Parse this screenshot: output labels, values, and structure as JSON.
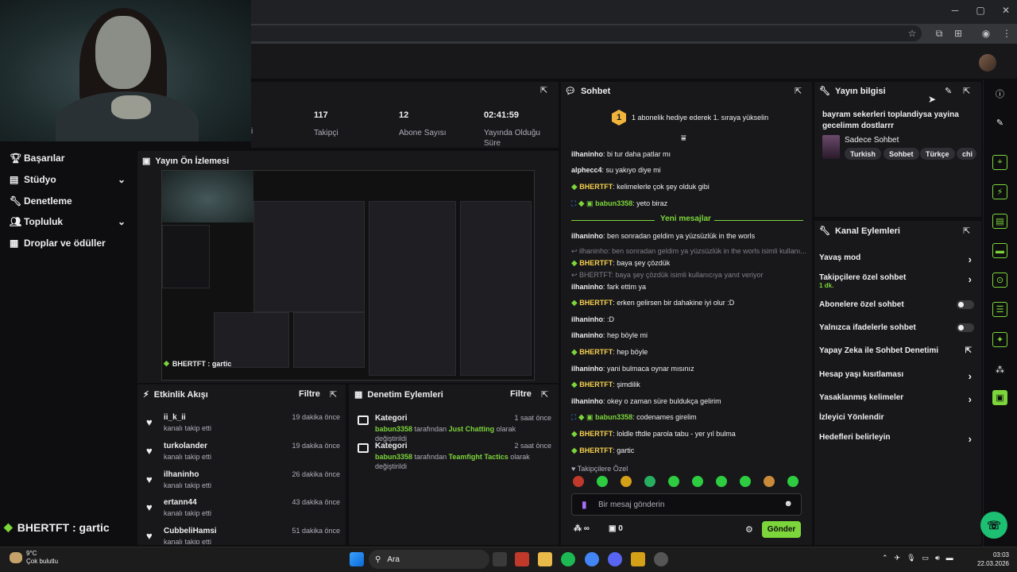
{
  "stats": {
    "items": [
      {
        "value": "117",
        "label": "Takipçi"
      },
      {
        "value": "12",
        "label": "Abone Sayısı"
      },
      {
        "value": "02:41:59",
        "label": "Yayında Olduğu Süre"
      }
    ],
    "partial_label": "i"
  },
  "sidebar": {
    "items": [
      {
        "label": "Başarılar",
        "icon": "trophy-icon",
        "expandable": false
      },
      {
        "label": "Stüdyo",
        "icon": "studio-icon",
        "expandable": true
      },
      {
        "label": "Denetleme",
        "icon": "wrench-icon",
        "expandable": false
      },
      {
        "label": "Topluluk",
        "icon": "community-icon",
        "expandable": true
      },
      {
        "label": "Droplar ve ödüller",
        "icon": "gift-icon",
        "expandable": false
      }
    ],
    "now_playing": "BHERTFT : gartic"
  },
  "preview": {
    "title": "Yayın Ön İzlemesi",
    "overlay_label": "BHERTFT : gartic"
  },
  "activity": {
    "title": "Etkinlik Akışı",
    "filter": "Filtre",
    "events": [
      {
        "name": "ii_k_ii",
        "action": "kanalı takip etti",
        "time": "19 dakika önce"
      },
      {
        "name": "turkolander",
        "action": "kanalı takip etti",
        "time": "19 dakika önce"
      },
      {
        "name": "ilhaninho",
        "action": "kanalı takip etti",
        "time": "26 dakika önce"
      },
      {
        "name": "ertann44",
        "action": "kanalı takip etti",
        "time": "43 dakika önce"
      },
      {
        "name": "CubbeliHamsi",
        "action": "kanalı takip etti",
        "time": "51 dakika önce"
      }
    ]
  },
  "moderation": {
    "title": "Denetim Eylemleri",
    "filter": "Filtre",
    "items": [
      {
        "category": "Kategori",
        "user": "babun3358",
        "middle": "tarafından",
        "game": "Just Chatting",
        "suffix": "olarak değiştirildi",
        "time": "1 saat önce"
      },
      {
        "category": "Kategori",
        "user": "babun3358",
        "middle": "tarafından",
        "game": "Teamfight Tactics",
        "suffix": "olarak değiştirildi",
        "time": "2 saat önce"
      }
    ]
  },
  "chat": {
    "title": "Sohbet",
    "banner_rank": "1",
    "banner_text": "1 abonelik hediye ederek 1. sıraya yükselin",
    "new_messages": "Yeni mesajlar",
    "messages": [
      {
        "user": "ilhaninho",
        "cls": "u-ilhan",
        "text": "bi tur daha patlar mı"
      },
      {
        "user": "alphecc4",
        "cls": "u-alph",
        "text": "su yakıyo diye mi"
      },
      {
        "user": "BHERTFT",
        "cls": "u-bhert",
        "text": "kelimelerle çok şey olduk gibi"
      },
      {
        "user": "babun3358",
        "cls": "u-babun",
        "text": "yeto biraz"
      },
      {
        "user": "ilhaninho",
        "cls": "u-ilhan",
        "text": "ben sonradan geldim ya yüzsüzlük in the worls"
      },
      {
        "reply": "ilhaninho: ben sonradan geldim ya yüzsüzlük in the worls isimli kullanı...",
        "user": "BHERTFT",
        "cls": "u-bhert",
        "text": "baya şey çözdük"
      },
      {
        "reply": "BHERTFT: baya şey çözdük isimli kullanıcıya yanıt veriyor",
        "user": "ilhaninho",
        "cls": "u-ilhan",
        "text": "fark ettim ya"
      },
      {
        "user": "BHERTFT",
        "cls": "u-bhert",
        "text": "erken gelirsen bir dahakine iyi olur :D"
      },
      {
        "user": "ilhaninho",
        "cls": "u-ilhan",
        "text": ":D"
      },
      {
        "user": "ilhaninho",
        "cls": "u-ilhan",
        "text": "hep böyle mi"
      },
      {
        "user": "BHERTFT",
        "cls": "u-bhert",
        "text": "hep böyle"
      },
      {
        "user": "ilhaninho",
        "cls": "u-ilhan",
        "text": "yani bulmaca oynar mısınız"
      },
      {
        "user": "BHERTFT",
        "cls": "u-bhert",
        "text": "şimdilik"
      },
      {
        "user": "ilhaninho",
        "cls": "u-ilhan",
        "text": "okey o zaman süre buldukça gelirim"
      },
      {
        "user": "babun3358",
        "cls": "u-babun",
        "text": "codenames girelim"
      },
      {
        "user": "BHERTFT",
        "cls": "u-bhert",
        "text": "loldle tftdle parola tabu - yer yıl bulma"
      },
      {
        "user": "BHERTFT",
        "cls": "u-bhert",
        "text": "gartic"
      }
    ],
    "emote_section": "Takipçilere Özel",
    "input_placeholder": "Bir mesaj gönderin",
    "points": "∞",
    "gift_count": "0",
    "send_label": "Gönder"
  },
  "stream_info": {
    "title": "Yayın bilgisi",
    "stream_title": "bayram sekerleri toplandiysa yayina gecelimm dostlarrr",
    "category": "Sadece Sohbet",
    "tags": [
      "Turkish",
      "Sohbet",
      "Türkçe",
      "chi"
    ]
  },
  "channel_actions": {
    "title": "Kanal Eylemleri",
    "items": [
      {
        "label": "Yavaş mod",
        "sub": "",
        "control": "chevron"
      },
      {
        "label": "Takipçilere özel sohbet",
        "sub": "1 dk.",
        "control": "chevron"
      },
      {
        "label": "Abonelere özel sohbet",
        "sub": "",
        "control": "toggle"
      },
      {
        "label": "Yalnızca ifadelerle sohbet",
        "sub": "",
        "control": "toggle"
      },
      {
        "label": "Yapay Zeka ile Sohbet Denetimi",
        "sub": "",
        "control": "external"
      },
      {
        "label": "Hesap yaşı kısıtlaması",
        "sub": "",
        "control": "chevron"
      },
      {
        "label": "Yasaklanmış kelimeler",
        "sub": "",
        "control": "chevron"
      },
      {
        "label": "İzleyici Yönlendir",
        "sub": "",
        "control": "none"
      },
      {
        "label": "Hedefleri belirleyin",
        "sub": "",
        "control": "chevron"
      }
    ]
  },
  "taskbar": {
    "temperature": "9°C",
    "weather": "Çok bulutlu",
    "search": "Ara",
    "time": "03:03",
    "date": "22.03.2026"
  },
  "colors": {
    "accent_green": "#7cd53a",
    "panel_bg": "#18181b",
    "page_bg": "#0e0e10",
    "gold": "#f0b43c"
  }
}
